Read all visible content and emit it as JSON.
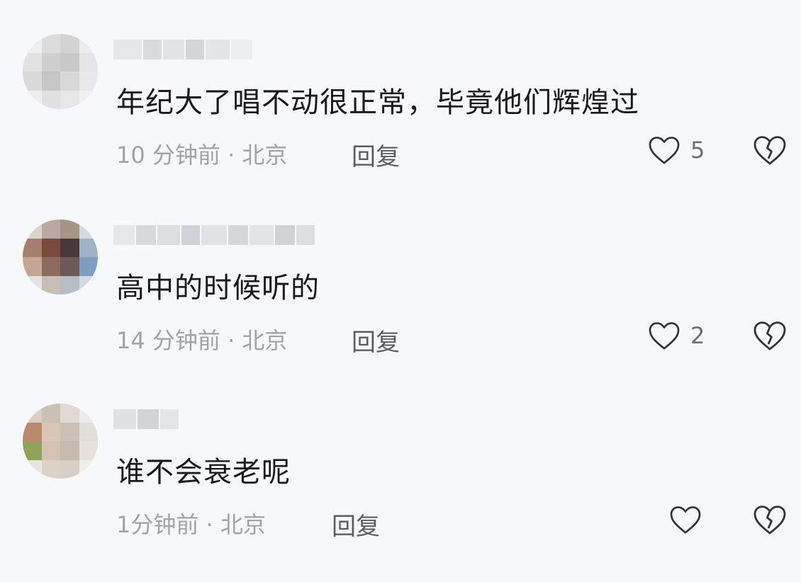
{
  "comments": [
    {
      "text": "年纪大了唱不动很正常，毕竟他们辉煌过",
      "time": "10 分钟前",
      "location": "北京",
      "reply_label": "回复",
      "likes": "5"
    },
    {
      "text": "高中的时候听的",
      "time": "14 分钟前",
      "location": "北京",
      "reply_label": "回复",
      "likes": "2"
    },
    {
      "text": "谁不会衰老呢",
      "time": "1分钟前",
      "location": "北京",
      "reply_label": "回复",
      "likes": ""
    }
  ],
  "meta_separator": " · ",
  "icons": {
    "like": "heart-outline-icon",
    "dislike": "broken-heart-icon"
  },
  "colors": {
    "background": "#f7f8fa",
    "text": "#1a1a1a",
    "meta": "#a0a3a8",
    "reply": "#5a5d62",
    "icon": "#333333"
  }
}
